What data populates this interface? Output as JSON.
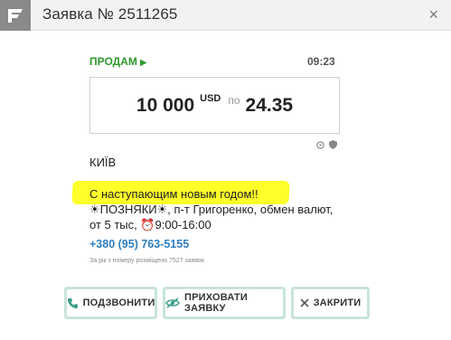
{
  "header": {
    "title": "Заявка № 2511265",
    "close_glyph": "×"
  },
  "offer": {
    "side_label": "ПРОДАМ",
    "side_glyph": "▶",
    "time": "09:23",
    "amount": "10 000",
    "currency": "USD",
    "rate_separator": "по",
    "rate": "24.35"
  },
  "details": {
    "city": "КИЇВ",
    "greeting": "С наступающим новым годом!!",
    "description": "☀ПОЗНЯКИ☀, п-т Григоренко, обмен валют, от 5 тыс, ⏰9:00-16:00",
    "phone": "+380 (95) 763-5155",
    "note": "За рік з номеру розміщено 7527 заявок"
  },
  "buttons": {
    "call": "ПОДЗВОНИТИ",
    "hide": "ПРИХОВАТИ ЗАЯВКУ",
    "close": "ЗАКРИТИ"
  },
  "colors": {
    "accent_green": "#2f9a2f",
    "phone_blue": "#2f7fc1",
    "highlight_yellow": "#ffff2a",
    "button_border": "#c8e4dc"
  },
  "icons": {
    "logo": "app-logo-icon",
    "call": "phone-icon",
    "hide": "eye-crossed-icon",
    "close": "close-icon",
    "info1": "network-icon",
    "info2": "shield-icon"
  }
}
